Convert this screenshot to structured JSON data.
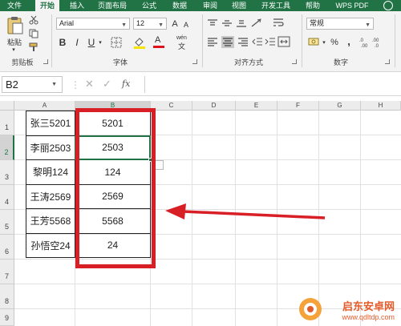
{
  "menu": {
    "tabs": [
      "文件",
      "开始",
      "插入",
      "页面布局",
      "公式",
      "数据",
      "审阅",
      "视图",
      "开发工具",
      "帮助",
      "WPS PDF"
    ],
    "active_tab": "开始"
  },
  "ribbon": {
    "clipboard": {
      "paste_label": "粘贴",
      "group_label": "剪贴板"
    },
    "font": {
      "font_name": "Arial",
      "font_size": "12",
      "bold": "B",
      "italic": "I",
      "underline": "U",
      "grow": "A",
      "shrink": "A",
      "fill_letter": "A",
      "wen": "wén",
      "group_label": "字体"
    },
    "alignment": {
      "group_label": "对齐方式"
    },
    "number": {
      "format": "常规",
      "percent": "%",
      "comma": ",",
      "group_label": "数字"
    }
  },
  "formula_bar": {
    "name_box": "B2",
    "fx": "fx",
    "formula": ""
  },
  "grid": {
    "columns": [
      "A",
      "B",
      "C",
      "D",
      "E",
      "F",
      "G",
      "H"
    ],
    "rows": [
      "1",
      "2",
      "3",
      "4",
      "5",
      "6",
      "7",
      "8",
      "9"
    ],
    "selected_cell": "B2",
    "data": [
      {
        "name": "张三5201",
        "number": "5201"
      },
      {
        "name": "李丽2503",
        "number": "2503"
      },
      {
        "name": "黎明124",
        "number": "124"
      },
      {
        "name": "王涛2569",
        "number": "2569"
      },
      {
        "name": "王芳5568",
        "number": "5568"
      },
      {
        "name": "孙悟空24",
        "number": "24"
      }
    ]
  },
  "watermark": {
    "text": "启东安卓网",
    "url": "www.qdltdp.com"
  },
  "colors": {
    "excel_green": "#217346",
    "annotation_red": "#d91f26",
    "watermark_orange": "#e45b2a"
  }
}
